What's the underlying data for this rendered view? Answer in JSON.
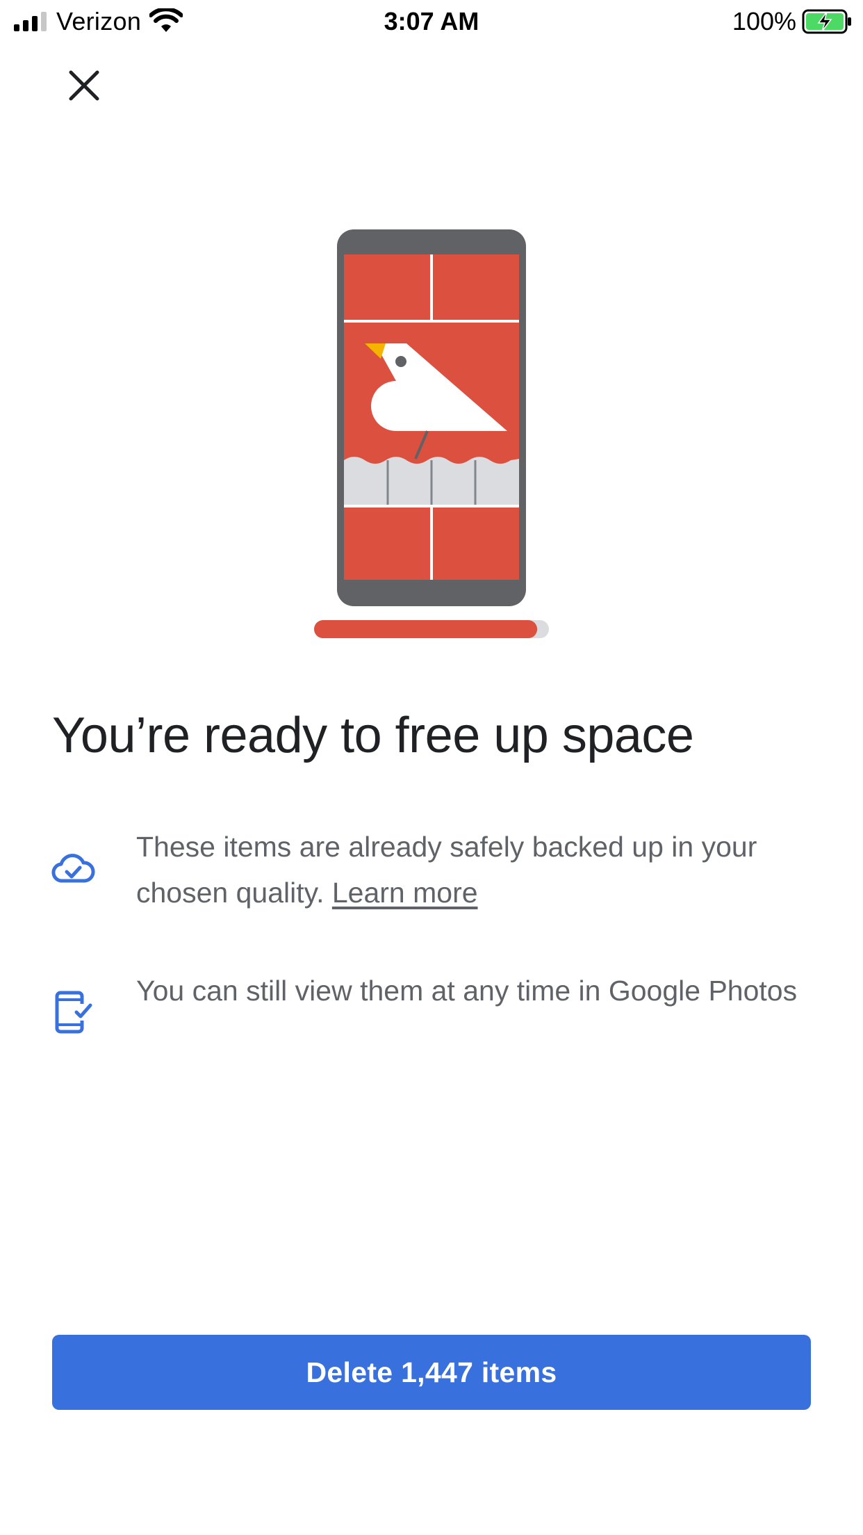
{
  "status_bar": {
    "carrier": "Verizon",
    "time": "3:07 AM",
    "battery_percent": "100%",
    "signal_bars": 3
  },
  "close": {
    "icon": "close-icon"
  },
  "title": "You’re ready to free up space",
  "info": [
    {
      "icon": "cloud-check-icon",
      "text": "These items are already safely backed up in your chosen quality. ",
      "link": "Learn more"
    },
    {
      "icon": "phone-check-icon",
      "text": "You can still view them at any time in Google Photos"
    }
  ],
  "progress": 0.95,
  "primary_button": {
    "label": "Delete 1,447 items"
  },
  "colors": {
    "accent": "#3871de",
    "illustration_red": "#dc5040",
    "phone_body": "#606266",
    "icon_blue": "#3871de"
  }
}
